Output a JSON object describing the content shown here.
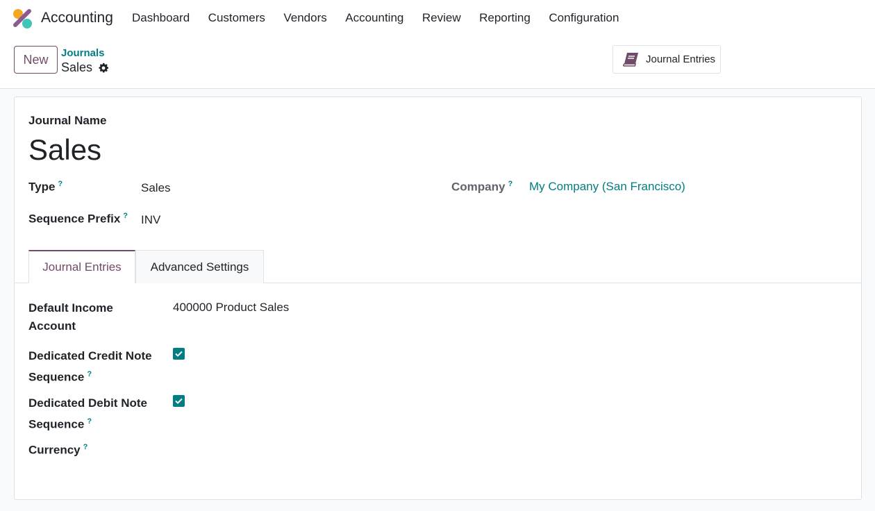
{
  "app": {
    "title": "Accounting"
  },
  "menu": [
    "Dashboard",
    "Customers",
    "Vendors",
    "Accounting",
    "Review",
    "Reporting",
    "Configuration"
  ],
  "control_panel": {
    "new_label": "New",
    "breadcrumb_parent": "Journals",
    "breadcrumb_current": "Sales",
    "smart_button_label": "Journal Entries"
  },
  "form": {
    "journal_name_label": "Journal Name",
    "journal_name": "Sales",
    "type_label": "Type",
    "type_value": "Sales",
    "sequence_prefix_label": "Sequence Prefix",
    "sequence_prefix_value": "INV",
    "company_label": "Company",
    "company_value": "My Company (San Francisco)",
    "help_mark": "?"
  },
  "tabs": [
    {
      "label": "Journal Entries",
      "active": true
    },
    {
      "label": "Advanced Settings",
      "active": false
    }
  ],
  "journal_entries_tab": {
    "default_income_account_label_line1": "Default Income",
    "default_income_account_label_line2": "Account",
    "default_income_account_value": "400000 Product Sales",
    "credit_note_label_line1": "Dedicated Credit Note",
    "credit_note_label_line2": "Sequence",
    "credit_note_checked": true,
    "debit_note_label_line1": "Dedicated Debit Note",
    "debit_note_label_line2": "Sequence",
    "debit_note_checked": true,
    "currency_label": "Currency",
    "currency_value": ""
  },
  "colors": {
    "brand": "#714b67",
    "link": "#017e84",
    "border": "#dee2e6"
  }
}
